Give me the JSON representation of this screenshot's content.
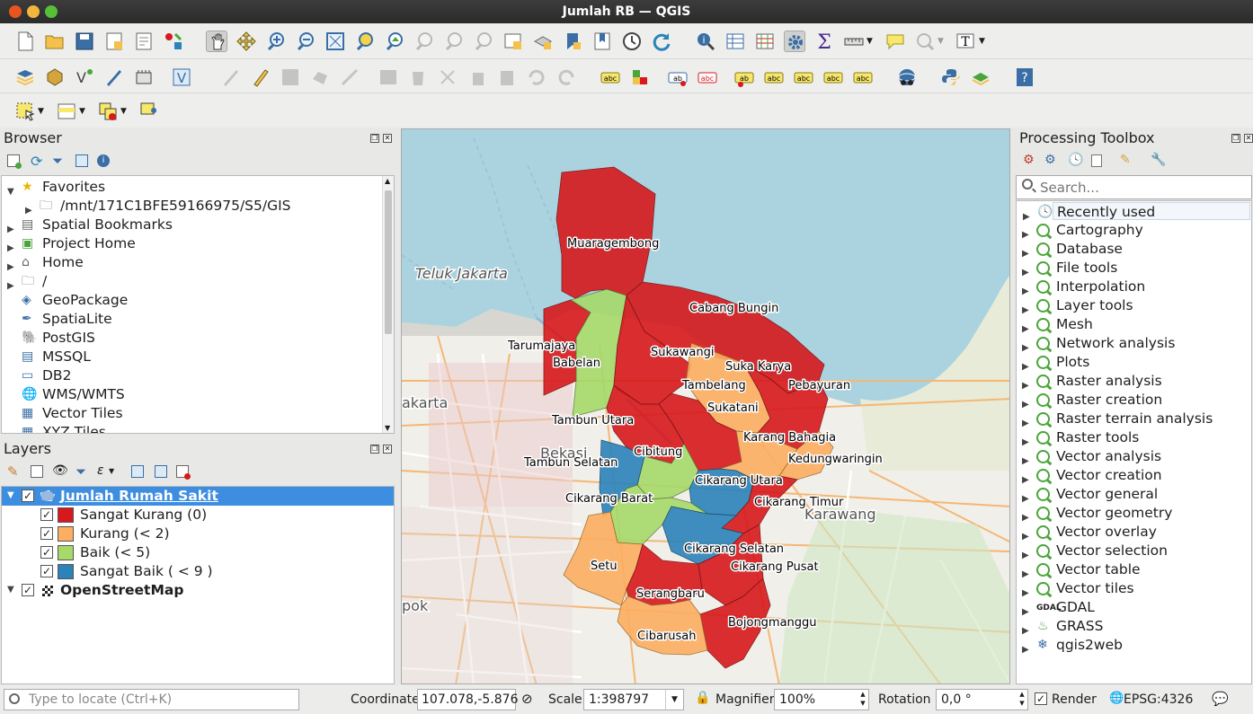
{
  "window": {
    "title": "Jumlah RB — QGIS"
  },
  "browser": {
    "title": "Browser",
    "items": [
      {
        "label": "Favorites",
        "icon": "star-icon"
      },
      {
        "label": "/mnt/171C1BFE59166975/S5/GIS",
        "icon": "folder-icon"
      },
      {
        "label": "Spatial Bookmarks",
        "icon": "bookmark-icon"
      },
      {
        "label": "Project Home",
        "icon": "project-home-icon"
      },
      {
        "label": "Home",
        "icon": "home-icon"
      },
      {
        "label": "/",
        "icon": "folder-icon"
      },
      {
        "label": "GeoPackage",
        "icon": "geopackage-icon"
      },
      {
        "label": "SpatiaLite",
        "icon": "spatialite-icon"
      },
      {
        "label": "PostGIS",
        "icon": "postgis-icon"
      },
      {
        "label": "MSSQL",
        "icon": "mssql-icon"
      },
      {
        "label": "DB2",
        "icon": "db2-icon"
      },
      {
        "label": "WMS/WMTS",
        "icon": "globe-icon"
      },
      {
        "label": "Vector Tiles",
        "icon": "grid-icon"
      },
      {
        "label": "XYZ Tiles",
        "icon": "grid-icon"
      }
    ]
  },
  "layers": {
    "title": "Layers",
    "layer1": {
      "name": "Jumlah Rumah Sakit"
    },
    "legend": [
      {
        "label": "Sangat Kurang (0)",
        "color": "#d7191c"
      },
      {
        "label": "Kurang (< 2)",
        "color": "#fdae61"
      },
      {
        "label": "Baik (< 5)",
        "color": "#a6d96a"
      },
      {
        "label": "Sangat Baik ( < 9 )",
        "color": "#2b83ba"
      }
    ],
    "layer2": {
      "name": "OpenStreetMap"
    }
  },
  "map": {
    "region_labels": [
      "Muaragembong",
      "Cabang Bungin",
      "Tarumajaya",
      "Babelan",
      "Sukawangi",
      "Suka Karya",
      "Tambelang",
      "Pebayuran",
      "Sukatani",
      "Tambun Utara",
      "Karang Bahagia",
      "Cibitung",
      "Kedungwaringin",
      "Tambun Selatan",
      "Cikarang Utara",
      "Cikarang Barat",
      "Cikarang Timur",
      "Cikarang Selatan",
      "Setu",
      "Cikarang Pusat",
      "Serangbaru",
      "Bojongmanggu",
      "Cibarusah"
    ],
    "base_labels": [
      "Teluk Jakarta",
      "Bekasi",
      "Karawang",
      "akarta",
      "pok"
    ]
  },
  "processing": {
    "title": "Processing Toolbox",
    "search_placeholder": "Search...",
    "items": [
      {
        "label": "Recently used",
        "icon": "clock-icon"
      },
      {
        "label": "Cartography",
        "icon": "qgis-icon"
      },
      {
        "label": "Database",
        "icon": "qgis-icon"
      },
      {
        "label": "File tools",
        "icon": "qgis-icon"
      },
      {
        "label": "Interpolation",
        "icon": "qgis-icon"
      },
      {
        "label": "Layer tools",
        "icon": "qgis-icon"
      },
      {
        "label": "Mesh",
        "icon": "qgis-icon"
      },
      {
        "label": "Network analysis",
        "icon": "qgis-icon"
      },
      {
        "label": "Plots",
        "icon": "qgis-icon"
      },
      {
        "label": "Raster analysis",
        "icon": "qgis-icon"
      },
      {
        "label": "Raster creation",
        "icon": "qgis-icon"
      },
      {
        "label": "Raster terrain analysis",
        "icon": "qgis-icon"
      },
      {
        "label": "Raster tools",
        "icon": "qgis-icon"
      },
      {
        "label": "Vector analysis",
        "icon": "qgis-icon"
      },
      {
        "label": "Vector creation",
        "icon": "qgis-icon"
      },
      {
        "label": "Vector general",
        "icon": "qgis-icon"
      },
      {
        "label": "Vector geometry",
        "icon": "qgis-icon"
      },
      {
        "label": "Vector overlay",
        "icon": "qgis-icon"
      },
      {
        "label": "Vector selection",
        "icon": "qgis-icon"
      },
      {
        "label": "Vector table",
        "icon": "qgis-icon"
      },
      {
        "label": "Vector tiles",
        "icon": "qgis-icon"
      },
      {
        "label": "GDAL",
        "icon": "gdal-icon"
      },
      {
        "label": "GRASS",
        "icon": "grass-icon"
      },
      {
        "label": "qgis2web",
        "icon": "gear-icon"
      }
    ]
  },
  "statusbar": {
    "locate_placeholder": "Type to locate (Ctrl+K)",
    "coordinate_label": "Coordinate",
    "coordinate_value": "107.078,-5.876",
    "scale_label": "Scale",
    "scale_value": "1:398797",
    "magnifier_label": "Magnifier",
    "magnifier_value": "100%",
    "rotation_label": "Rotation",
    "rotation_value": "0,0 °",
    "render_label": "Render",
    "crs_label": "EPSG:4326"
  }
}
